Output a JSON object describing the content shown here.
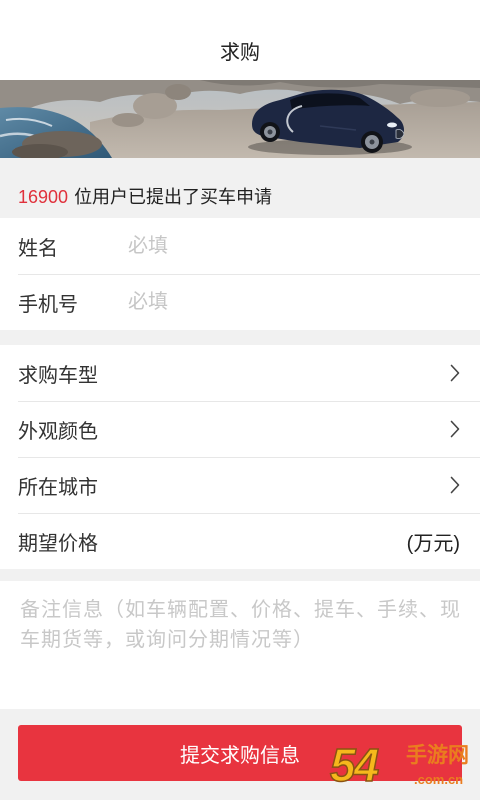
{
  "header": {
    "title": "求购"
  },
  "stats": {
    "count": "16900",
    "suffix": "位用户已提出了买车申请"
  },
  "contact": {
    "name": {
      "label": "姓名",
      "placeholder": "必填"
    },
    "phone": {
      "label": "手机号",
      "placeholder": "必填"
    }
  },
  "options": [
    {
      "label": "求购车型",
      "icon": "chevron-right-icon"
    },
    {
      "label": "外观颜色",
      "icon": "chevron-right-icon"
    },
    {
      "label": "所在城市",
      "icon": "chevron-right-icon"
    }
  ],
  "price": {
    "label": "期望价格",
    "unit": "(万元)"
  },
  "remarks": {
    "placeholder": "备注信息（如车辆配置、价格、提车、手续、现车期货等，或询问分期情况等）"
  },
  "submit": {
    "label": "提交求购信息"
  },
  "watermark": {
    "digits": "54",
    "name": "手游网",
    "domain": ".com.cn"
  },
  "theme": {
    "accent": "#e8343f",
    "highlight": "#e0313c",
    "background": "#f1f1f1",
    "text": "#333333",
    "placeholder": "#c6c6c6"
  }
}
